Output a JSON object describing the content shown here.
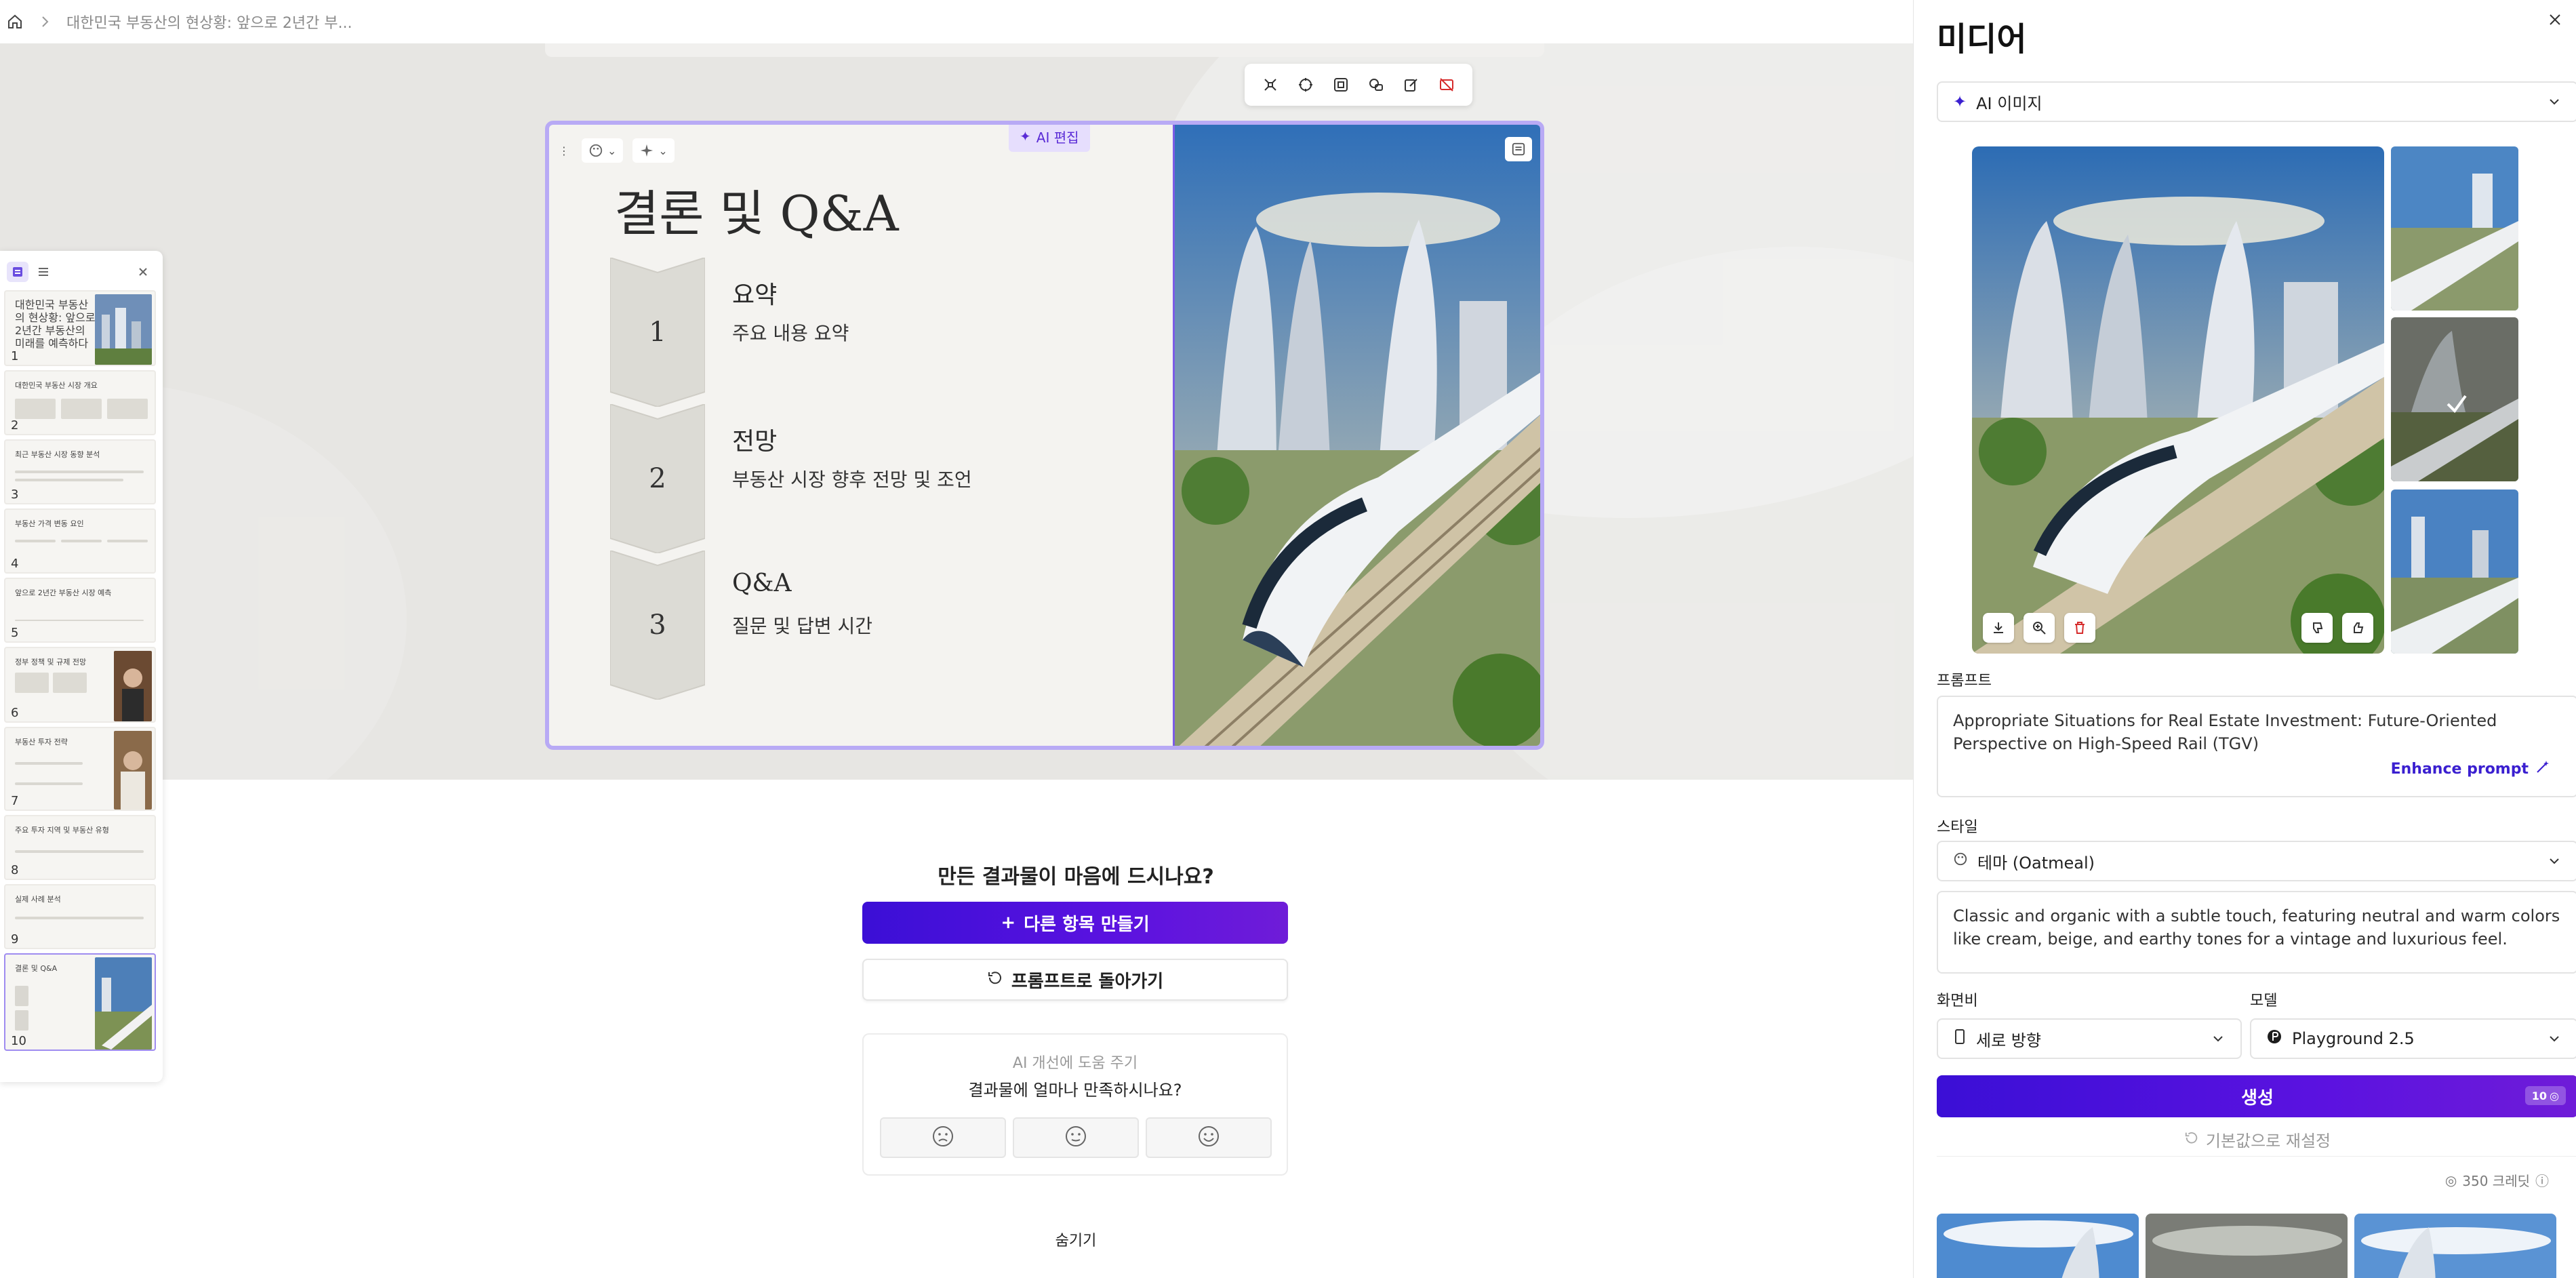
{
  "breadcrumb": {
    "title": "대한민국 부동산의 현상황: 앞으로 2년간 부..."
  },
  "slide": {
    "ai_edit_label": "AI 편집",
    "title": "결론 및 Q&A",
    "items": [
      {
        "number": "1",
        "heading": "요약",
        "description": "주요 내용 요약"
      },
      {
        "number": "2",
        "heading": "전망",
        "description": "부동산 시장 향후 전망 및 조언"
      },
      {
        "number": "3",
        "heading": "Q&A",
        "description": "질문 및 답변 시간"
      }
    ]
  },
  "thumbnails": [
    {
      "number": "1",
      "label": "대한민국 부동산의 현상황: 앞으로 2년간 부동산의 미래를 예측하다"
    },
    {
      "number": "2",
      "label": "대한민국 부동산 시장 개요"
    },
    {
      "number": "3",
      "label": "최근 부동산 시장 동향 분석"
    },
    {
      "number": "4",
      "label": "부동산 가격 변동 요인"
    },
    {
      "number": "5",
      "label": "앞으로 2년간 부동산 시장 예측"
    },
    {
      "number": "6",
      "label": "정부 정책 및 규제 전망"
    },
    {
      "number": "7",
      "label": "부동산 투자 전략"
    },
    {
      "number": "8",
      "label": "주요 투자 지역 및 부동산 유형"
    },
    {
      "number": "9",
      "label": "실제 사례 분석"
    },
    {
      "number": "10",
      "label": "결론 및 Q&A"
    }
  ],
  "feedback": {
    "question": "만든 결과물이 마음에 드시나요?",
    "create_another": "다른 항목 만들기",
    "back_to_prompt": "프롬프트로 돌아가기",
    "help_improve": "AI 개선에 도움 주기",
    "satisfaction_question": "결과물에 얼마나 만족하시나요?",
    "hide": "숨기기"
  },
  "media_panel": {
    "title": "미디어",
    "source_select": "AI 이미지",
    "prompt_label": "프롬프트",
    "prompt_text": "Appropriate Situations for Real Estate Investment: Future-Oriented Perspective on High-Speed Rail (TGV)",
    "enhance_prompt": "Enhance prompt",
    "style_label": "스타일",
    "style_select": "테마 (Oatmeal)",
    "style_description": "Classic and organic with a subtle touch, featuring neutral and warm colors like cream, beige, and earthy tones for a vintage and luxurious feel.",
    "aspect_label": "화면비",
    "aspect_select": "세로 방향",
    "model_label": "모델",
    "model_select": "Playground 2.5",
    "generate_label": "생성",
    "generate_cost": "10",
    "reset_label": "기본값으로 재설정",
    "credits": "350 크레딧"
  },
  "colors": {
    "accent": "#5b12e0",
    "selection_border": "#b8aaf5",
    "canvas_bg": "#e7e6e3",
    "slide_bg": "#f4f3f0"
  }
}
